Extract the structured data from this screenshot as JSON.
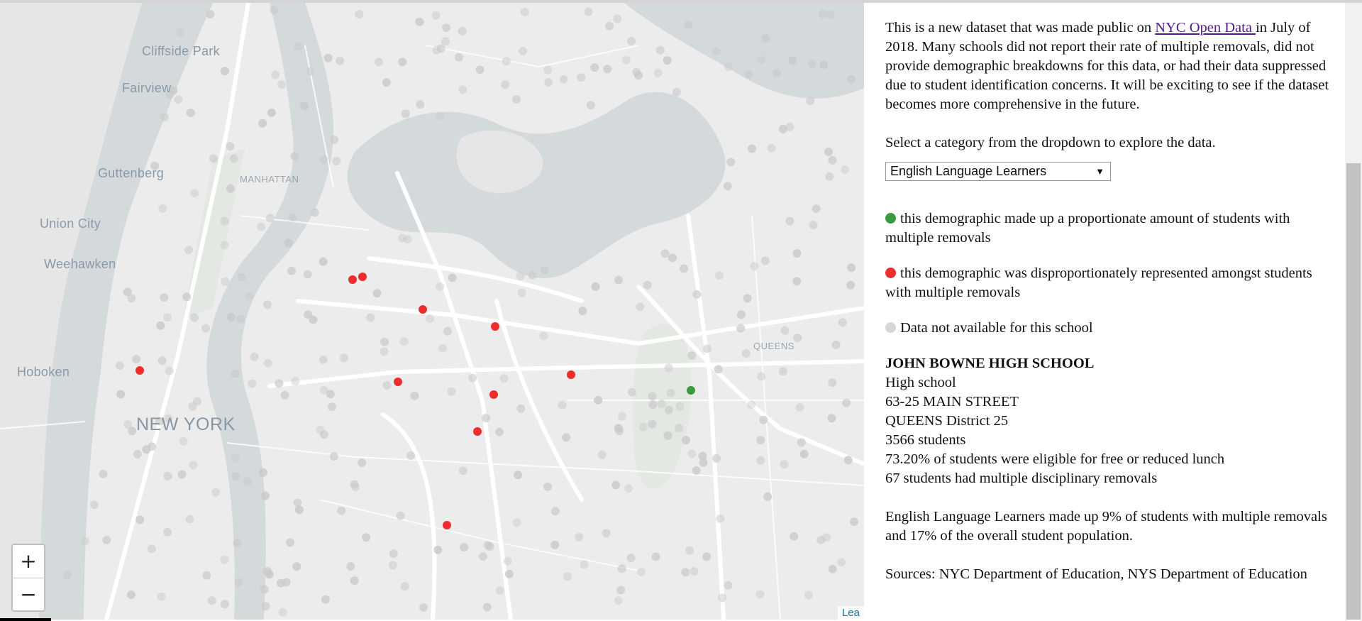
{
  "map": {
    "places": {
      "cliffside_park": "Cliffside Park",
      "fairview": "Fairview",
      "guttenberg": "Guttenberg",
      "manhattan": "MANHATTAN",
      "union_city": "Union City",
      "weehawken": "Weehawken",
      "hoboken": "Hoboken",
      "new_york": "NEW YORK",
      "queens": "QUEENS"
    },
    "zoom_in": "+",
    "zoom_out": "−",
    "attribution": "Lea",
    "colors": {
      "land": "#ececec",
      "water": "#d4dadc",
      "road": "#ffffff",
      "park": "#e3e8e3",
      "proportionate": "#3a9a3e",
      "disproportionate": "#ee2d2d",
      "unavailable": "#c9c9c9"
    }
  },
  "panel": {
    "intro_before_link": "This is a new dataset that was made public on ",
    "intro_link": "NYC Open Data ",
    "intro_after_link": "in July of 2018. Many schools did not report their rate of multiple removals, did not provide demographic breakdowns for this data, or had their data suppressed due to student identification concerns. It will be exciting to see if the dataset becomes more comprehensive in the future.",
    "select_prompt": "Select a category from the dropdown to explore the data.",
    "dropdown": {
      "selected": "English Language Learners",
      "caret": "▼"
    },
    "legend": {
      "proportionate": "this demographic made up a proportionate amount of students with multiple removals",
      "disproportionate": "this demographic was disproportionately represented amongst students with multiple removals",
      "unavailable": "Data not available for this school"
    },
    "school": {
      "name": "JOHN BOWNE HIGH SCHOOL",
      "type": "High school",
      "address": "63-25 MAIN STREET",
      "district": "QUEENS District 25",
      "students": "3566 students",
      "lunch": "73.20% of students were eligible for free or reduced lunch",
      "removals": "67 students had multiple disciplinary removals"
    },
    "summary": "English Language Learners made up 9% of students with multiple removals and 17% of the overall student population.",
    "sources": "Sources: NYC Department of Education, NYS Department of Education"
  }
}
